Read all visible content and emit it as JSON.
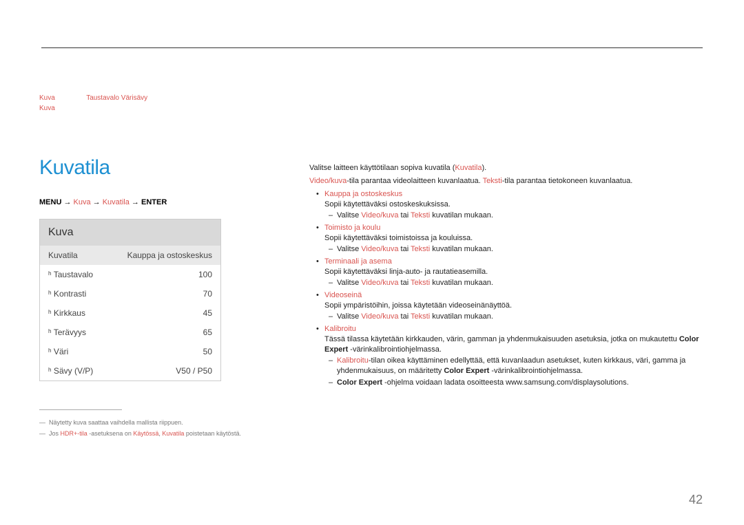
{
  "chapter_title": "",
  "intro": {
    "line1_pre": "",
    "hl1": "Kuva",
    "mid1": "",
    "hl2": "Taustavalo",
    "mid2": "",
    "hl3": "Värisävy",
    "line1_post": "",
    "hl4": "Kuva",
    "line2_post": ""
  },
  "section_title": "Kuvatila",
  "breadcrumb": {
    "menu": "MENU",
    "arrow1": " → ",
    "kuva": "Kuva",
    "arrow2": "   → ",
    "kuvatila": "Kuvatila",
    "arrow3": " → ",
    "enter": "ENTER"
  },
  "panel": {
    "header": "Kuva",
    "rows": [
      {
        "label": "Kuvatila",
        "value": "Kauppa ja ostoskeskus"
      },
      {
        "label": "ʰ Taustavalo",
        "value": "100"
      },
      {
        "label": "ʰ Kontrasti",
        "value": "70"
      },
      {
        "label": "ʰ Kirkkaus",
        "value": "45"
      },
      {
        "label": "ʰ Terävyys",
        "value": "65"
      },
      {
        "label": "ʰ Väri",
        "value": "50"
      },
      {
        "label": "ʰ Sävy (V/P)",
        "value": "V50 / P50"
      }
    ]
  },
  "footnotes": {
    "f1": "Näytetty kuva saattaa vaihdella mallista riippuen.",
    "f2_pre": "Jos ",
    "f2_hl1": "HDR+-tila",
    "f2_mid1": " -asetuksena on ",
    "f2_hl2": "Käytössä",
    "f2_mid2": ", ",
    "f2_hl3": "Kuvatila",
    "f2_post": " poistetaan käytöstä."
  },
  "content": {
    "p1_pre": "Valitse laitteen käyttötilaan sopiva kuvatila (",
    "p1_hl": "Kuvatila",
    "p1_post": ").",
    "p2_hl1": "Video/kuva",
    "p2_mid1": "-tila parantaa videolaitteen kuvanlaatua. ",
    "p2_hl2": "Teksti",
    "p2_mid2": "-tila parantaa tietokoneen kuvanlaatua.",
    "items": [
      {
        "title": "Kauppa ja ostoskeskus",
        "desc": "Sopii käytettäväksi ostoskeskuksissa.",
        "sub_pre": "Valitse ",
        "sub_hl1": "Video/kuva",
        "sub_mid": " tai ",
        "sub_hl2": "Teksti",
        "sub_post": " kuvatilan mukaan."
      },
      {
        "title": "Toimisto ja koulu",
        "desc": "Sopii käytettäväksi toimistoissa ja kouluissa.",
        "sub_pre": "Valitse ",
        "sub_hl1": "Video/kuva",
        "sub_mid": " tai ",
        "sub_hl2": "Teksti",
        "sub_post": " kuvatilan mukaan."
      },
      {
        "title": "Terminaali ja asema",
        "desc": "Sopii käytettäväksi linja-auto- ja rautatieasemilla.",
        "sub_pre": "Valitse ",
        "sub_hl1": "Video/kuva",
        "sub_mid": " tai ",
        "sub_hl2": "Teksti",
        "sub_post": " kuvatilan mukaan."
      },
      {
        "title": "Videoseinä",
        "desc": "Sopii ympäristöihin, joissa käytetään videoseinänäyttöä.",
        "sub_pre": "Valitse ",
        "sub_hl1": "Video/kuva",
        "sub_mid": " tai ",
        "sub_hl2": "Teksti",
        "sub_post": " kuvatilan mukaan."
      }
    ],
    "cal_title": "Kalibroitu",
    "cal_desc_pre": "Tässä tilassa käytetään kirkkauden, värin, gamman ja yhdenmukaisuuden asetuksia, jotka on mukautettu ",
    "cal_desc_bold1": "Color Expert",
    "cal_desc_post": " -värinkalibrointiohjelmassa.",
    "cal_sub1_hl": "Kalibroitu",
    "cal_sub1_mid": "-tilan oikea käyttäminen edellyttää, että kuvanlaadun asetukset, kuten kirkkaus, väri, gamma ja yhdenmukaisuus, on määritetty ",
    "cal_sub1_bold": "Color Expert",
    "cal_sub1_post": " -värinkalibrointiohjelmassa.",
    "cal_sub2_bold": "Color Expert",
    "cal_sub2_post": " -ohjelma voidaan ladata osoitteesta www.samsung.com/displaysolutions."
  },
  "page_number": "42"
}
